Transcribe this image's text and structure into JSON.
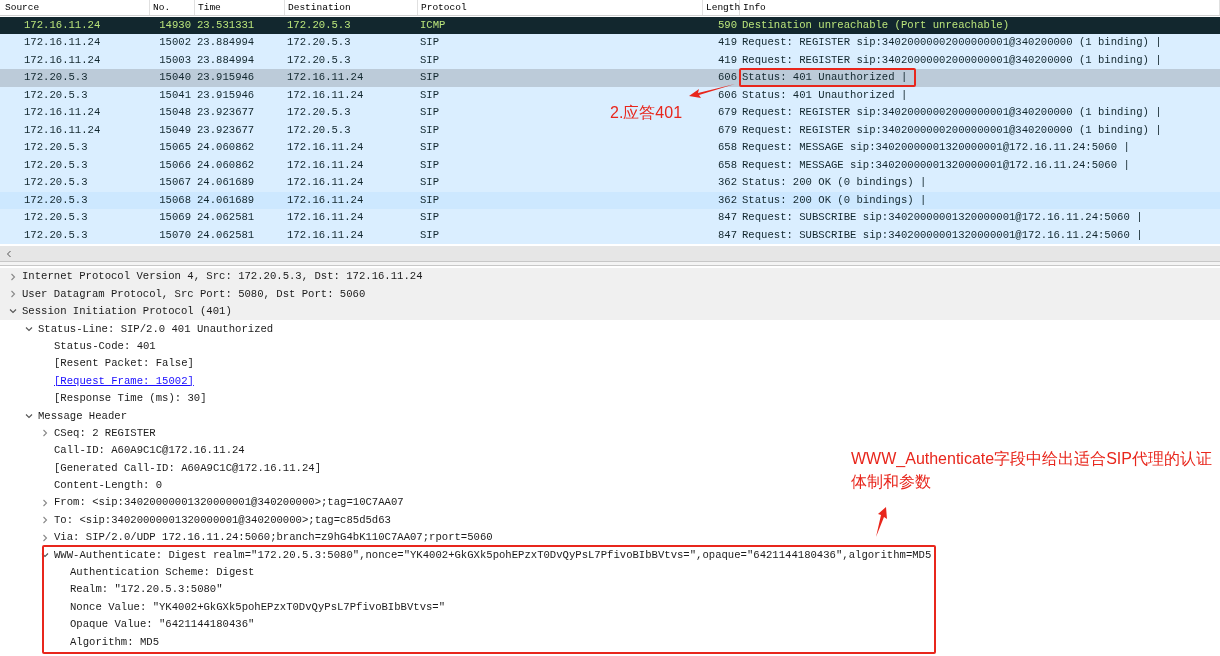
{
  "packet_list": {
    "columns": [
      "Source",
      "No.",
      "Time",
      "Destination",
      "Protocol",
      "Length",
      "Info"
    ],
    "rows": [
      {
        "kind": "icmp",
        "selected": false,
        "hovered": false,
        "cells": [
          "172.16.11.24",
          "14930",
          "23.531331",
          "172.20.5.3",
          "ICMP",
          "590",
          "Destination unreachable (Port unreachable)"
        ]
      },
      {
        "kind": "sip",
        "selected": false,
        "hovered": false,
        "cells": [
          "172.16.11.24",
          "15002",
          "23.884994",
          "172.20.5.3",
          "SIP",
          "419",
          "Request: REGISTER sip:34020000002000000001@340200000  (1 binding) |"
        ]
      },
      {
        "kind": "sip",
        "selected": false,
        "hovered": false,
        "cells": [
          "172.16.11.24",
          "15003",
          "23.884994",
          "172.20.5.3",
          "SIP",
          "419",
          "Request: REGISTER sip:34020000002000000001@340200000  (1 binding) |"
        ]
      },
      {
        "kind": "sip",
        "selected": true,
        "hovered": false,
        "cells": [
          "172.20.5.3",
          "15040",
          "23.915946",
          "172.16.11.24",
          "SIP",
          "606",
          "Status: 401 Unauthorized |"
        ]
      },
      {
        "kind": "sip",
        "selected": false,
        "hovered": false,
        "cells": [
          "172.20.5.3",
          "15041",
          "23.915946",
          "172.16.11.24",
          "SIP",
          "606",
          "Status: 401 Unauthorized |"
        ]
      },
      {
        "kind": "sip",
        "selected": false,
        "hovered": false,
        "cells": [
          "172.16.11.24",
          "15048",
          "23.923677",
          "172.20.5.3",
          "SIP",
          "679",
          "Request: REGISTER sip:34020000002000000001@340200000  (1 binding) |"
        ]
      },
      {
        "kind": "sip",
        "selected": false,
        "hovered": false,
        "cells": [
          "172.16.11.24",
          "15049",
          "23.923677",
          "172.20.5.3",
          "SIP",
          "679",
          "Request: REGISTER sip:34020000002000000001@340200000  (1 binding) |"
        ]
      },
      {
        "kind": "sip",
        "selected": false,
        "hovered": false,
        "cells": [
          "172.20.5.3",
          "15065",
          "24.060862",
          "172.16.11.24",
          "SIP",
          "658",
          "Request: MESSAGE sip:34020000001320000001@172.16.11.24:5060 |"
        ]
      },
      {
        "kind": "sip",
        "selected": false,
        "hovered": false,
        "cells": [
          "172.20.5.3",
          "15066",
          "24.060862",
          "172.16.11.24",
          "SIP",
          "658",
          "Request: MESSAGE sip:34020000001320000001@172.16.11.24:5060 |"
        ]
      },
      {
        "kind": "sip",
        "selected": false,
        "hovered": false,
        "cells": [
          "172.20.5.3",
          "15067",
          "24.061689",
          "172.16.11.24",
          "SIP",
          "362",
          "Status: 200 OK  (0 bindings) |"
        ]
      },
      {
        "kind": "sip",
        "selected": false,
        "hovered": true,
        "cells": [
          "172.20.5.3",
          "15068",
          "24.061689",
          "172.16.11.24",
          "SIP",
          "362",
          "Status: 200 OK  (0 bindings) |"
        ]
      },
      {
        "kind": "sip",
        "selected": false,
        "hovered": false,
        "cells": [
          "172.20.5.3",
          "15069",
          "24.062581",
          "172.16.11.24",
          "SIP",
          "847",
          "Request: SUBSCRIBE sip:34020000001320000001@172.16.11.24:5060 |"
        ]
      },
      {
        "kind": "sip",
        "selected": false,
        "hovered": false,
        "cells": [
          "172.20.5.3",
          "15070",
          "24.062581",
          "172.16.11.24",
          "SIP",
          "847",
          "Request: SUBSCRIBE sip:34020000001320000001@172.16.11.24:5060 |"
        ]
      }
    ]
  },
  "packet_details": [
    {
      "text": "Internet Protocol Version 4, Src: 172.20.5.3, Dst: 172.16.11.24",
      "expanded": false
    },
    {
      "text": "User Datagram Protocol, Src Port: 5080, Dst Port: 5060",
      "expanded": false
    },
    {
      "text": "Session Initiation Protocol (401)",
      "expanded": true,
      "children": [
        {
          "text": "Status-Line: SIP/2.0 401 Unauthorized",
          "expanded": true,
          "children": [
            {
              "text": "Status-Code: 401"
            },
            {
              "text": "[Resent Packet: False]"
            },
            {
              "text": "[Request Frame: 15002]",
              "kind": "link"
            },
            {
              "text": "[Response Time (ms): 30]"
            }
          ]
        },
        {
          "text": "Message Header",
          "expanded": true,
          "children": [
            {
              "text": "CSeq: 2 REGISTER",
              "expanded": false
            },
            {
              "text": "Call-ID: A60A9C1C@172.16.11.24"
            },
            {
              "text": "[Generated Call-ID: A60A9C1C@172.16.11.24]"
            },
            {
              "text": "Content-Length: 0"
            },
            {
              "text": "From: <sip:34020000001320000001@340200000>;tag=10C7AA07",
              "expanded": false
            },
            {
              "text": "To: <sip:34020000001320000001@340200000>;tag=c85d5d63",
              "expanded": false
            },
            {
              "text": "Via: SIP/2.0/UDP 172.16.11.24:5060;branch=z9hG4bK110C7AA07;rport=5060",
              "expanded": false
            },
            {
              "text": "WWW-Authenticate: Digest realm=\"172.20.5.3:5080\",nonce=\"YK4002+GkGXk5pohEPzxT0DvQyPsL7PfivoBIbBVtvs=\",opaque=\"6421144180436\",algorithm=MD5",
              "expanded": true,
              "children": [
                {
                  "text": "Authentication Scheme: Digest"
                },
                {
                  "text": "Realm: \"172.20.5.3:5080\""
                },
                {
                  "text": "Nonce Value: \"YK4002+GkGXk5pohEPzxT0DvQyPsL7PfivoBIbBVtvs=\""
                },
                {
                  "text": "Opaque Value: \"6421144180436\""
                },
                {
                  "text": "Algorithm: MD5"
                }
              ]
            }
          ]
        }
      ]
    }
  ],
  "annotations": [
    {
      "text": "2.应答401"
    },
    {
      "text": "WWW_Authenticate字段中给出适合SIP代理的认证体制和参数"
    }
  ]
}
